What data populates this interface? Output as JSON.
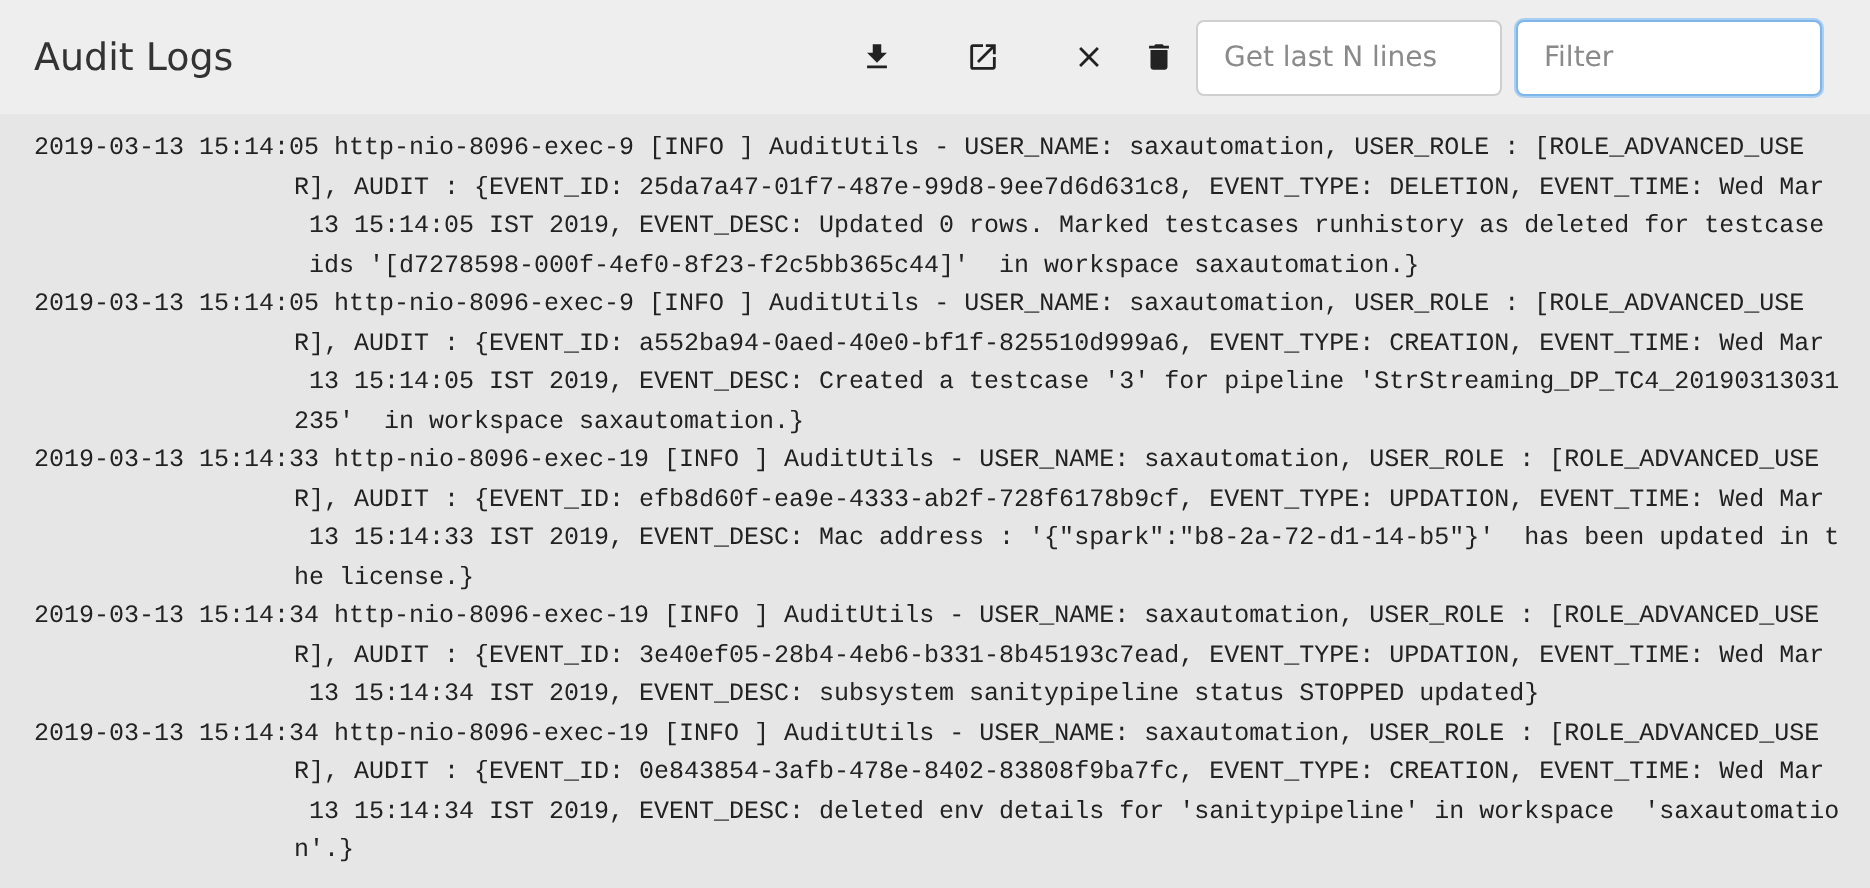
{
  "header": {
    "title": "Audit Logs",
    "fields": [
      {
        "placeholder": "Get last N lines",
        "focused": false
      },
      {
        "placeholder": "Filter",
        "focused": true
      }
    ]
  },
  "log": {
    "entries": [
      {
        "lines": [
          "2019-03-13 15:14:05 http-nio-8096-exec-9 [INFO ] AuditUtils - USER_NAME: saxautomation, USER_ROLE : [ROLE_ADVANCED_USE",
          "R], AUDIT : {EVENT_ID: 25da7a47-01f7-487e-99d8-9ee7d6d631c8, EVENT_TYPE: DELETION, EVENT_TIME: Wed Mar",
          " 13 15:14:05 IST 2019, EVENT_DESC: Updated 0 rows. Marked testcases runhistory as deleted for testcase",
          " ids '[d7278598-000f-4ef0-8f23-f2c5bb365c44]'  in workspace saxautomation.}"
        ]
      },
      {
        "lines": [
          "2019-03-13 15:14:05 http-nio-8096-exec-9 [INFO ] AuditUtils - USER_NAME: saxautomation, USER_ROLE : [ROLE_ADVANCED_USE",
          "R], AUDIT : {EVENT_ID: a552ba94-0aed-40e0-bf1f-825510d999a6, EVENT_TYPE: CREATION, EVENT_TIME: Wed Mar",
          " 13 15:14:05 IST 2019, EVENT_DESC: Created a testcase '3' for pipeline 'StrStreaming_DP_TC4_20190313031",
          "235'  in workspace saxautomation.}"
        ]
      },
      {
        "lines": [
          "2019-03-13 15:14:33 http-nio-8096-exec-19 [INFO ] AuditUtils - USER_NAME: saxautomation, USER_ROLE : [ROLE_ADVANCED_USE",
          "R], AUDIT : {EVENT_ID: efb8d60f-ea9e-4333-ab2f-728f6178b9cf, EVENT_TYPE: UPDATION, EVENT_TIME: Wed Mar",
          " 13 15:14:33 IST 2019, EVENT_DESC: Mac address : '{\"spark\":\"b8-2a-72-d1-14-b5\"}'  has been updated in t",
          "he license.}"
        ]
      },
      {
        "lines": [
          "2019-03-13 15:14:34 http-nio-8096-exec-19 [INFO ] AuditUtils - USER_NAME: saxautomation, USER_ROLE : [ROLE_ADVANCED_USE",
          "R], AUDIT : {EVENT_ID: 3e40ef05-28b4-4eb6-b331-8b45193c7ead, EVENT_TYPE: UPDATION, EVENT_TIME: Wed Mar",
          " 13 15:14:34 IST 2019, EVENT_DESC: subsystem sanitypipeline status STOPPED updated}"
        ]
      },
      {
        "lines": [
          "2019-03-13 15:14:34 http-nio-8096-exec-19 [INFO ] AuditUtils - USER_NAME: saxautomation, USER_ROLE : [ROLE_ADVANCED_USE",
          "R], AUDIT : {EVENT_ID: 0e843854-3afb-478e-8402-83808f9ba7fc, EVENT_TYPE: CREATION, EVENT_TIME: Wed Mar",
          " 13 15:14:34 IST 2019, EVENT_DESC: deleted env details for 'sanitypipeline' in workspace  'saxautomatio",
          "n'.}"
        ]
      }
    ]
  }
}
